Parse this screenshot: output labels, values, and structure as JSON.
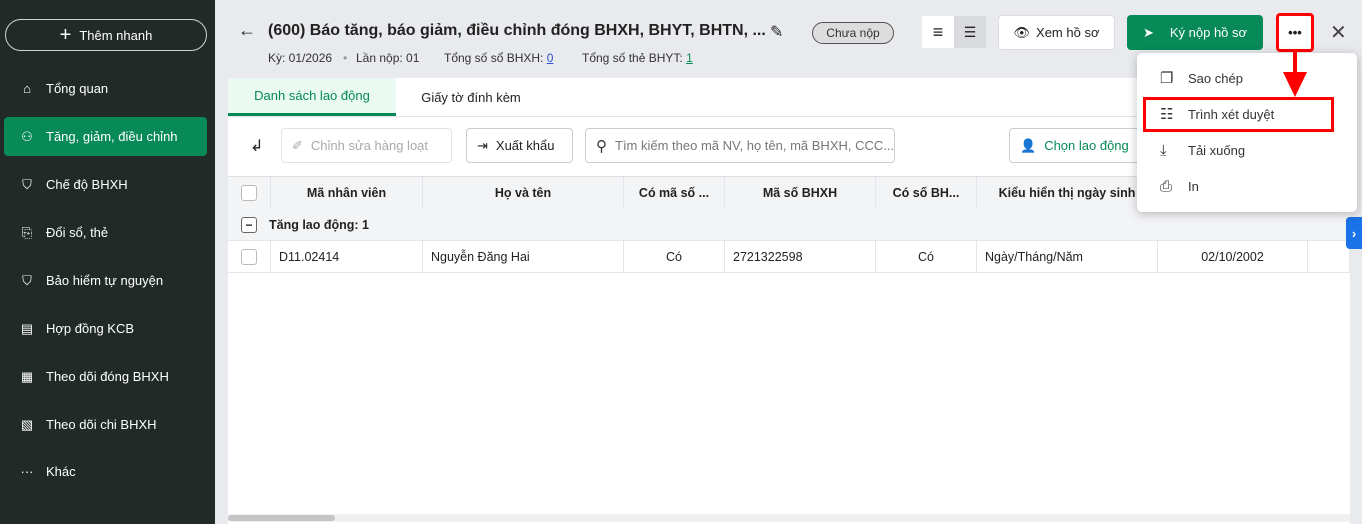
{
  "sidebar": {
    "quick_add": "Thêm nhanh",
    "items": [
      {
        "label": "Tổng quan",
        "icon": "home-icon"
      },
      {
        "label": "Tăng, giảm, điều chỉnh",
        "icon": "user-up-icon"
      },
      {
        "label": "Chế độ BHXH",
        "icon": "shield-icon"
      },
      {
        "label": "Đổi sổ, thẻ",
        "icon": "copy-icon"
      },
      {
        "label": "Bảo hiểm tự nguyện",
        "icon": "shield-heart-icon"
      },
      {
        "label": "Hợp đồng KCB",
        "icon": "contract-icon"
      },
      {
        "label": "Theo dõi đóng BHXH",
        "icon": "c12-icon"
      },
      {
        "label": "Theo dõi chi BHXH",
        "icon": "doc-icon"
      },
      {
        "label": "Khác",
        "icon": "more-icon"
      }
    ]
  },
  "header": {
    "title": "(600) Báo tăng, báo giảm, điều chỉnh đóng BHXH, BHYT, BHTN, ...",
    "status": "Chưa nộp",
    "period": "Kỳ: 01/2026",
    "submit_count": "Lần nộp: 01",
    "total_books_label": "Tổng số sổ BHXH:",
    "total_books": "0",
    "total_cards_label": "Tổng số thẻ BHYT:",
    "total_cards": "1",
    "view_button": "Xem hồ sơ",
    "sign_button": "Ký nộp hồ sơ"
  },
  "tabs": [
    "Danh sách lao động",
    "Giấy tờ đính kèm"
  ],
  "toolbar": {
    "bulk_edit": "Chỉnh sửa hàng loạt",
    "export": "Xuất khẩu",
    "search_placeholder": "Tìm kiếm theo mã NV, họ tên, mã BHXH, CCC...",
    "choose": "Chọn lao động"
  },
  "table": {
    "headers": [
      "Mã nhân viên",
      "Họ và tên",
      "Có mã số ...",
      "Mã số BHXH",
      "Có số BH...",
      "Kiểu hiển thị ngày sinh",
      ""
    ],
    "group": "Tăng lao động: 1",
    "rows": [
      [
        "D11.02414",
        "Nguyễn Đăng Hai",
        "Có",
        "2721322598",
        "Có",
        "Ngày/Tháng/Năm",
        "02/10/2002"
      ]
    ]
  },
  "menu": [
    "Sao chép",
    "Trình xét duyệt",
    "Tải xuống",
    "In"
  ],
  "colors": {
    "accent": "#078a57",
    "highlight": "#ff0000"
  }
}
